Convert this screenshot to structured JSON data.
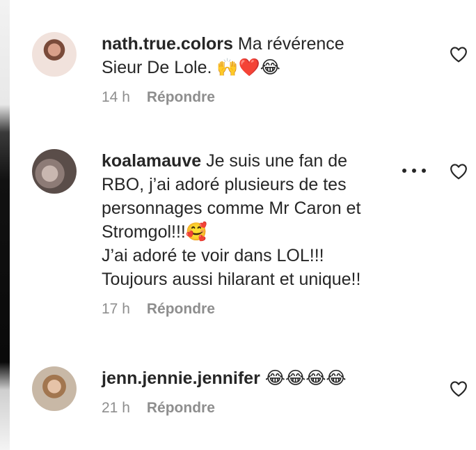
{
  "comments": [
    {
      "username": "nath.true.colors",
      "text": " Ma révérence\nSieur De Lole. 🙌❤️😂",
      "time": "14 h",
      "reply_label": "Répondre"
    },
    {
      "username": "koalamauve",
      "text": " Je suis une fan de\nRBO, j’ai adoré plusieurs de tes\npersonnages comme Mr Caron et\nStromgol!!!🥰\nJ’ai adoré te voir dans LOL!!!\nToujours aussi hilarant et unique!!",
      "time": "17 h",
      "reply_label": "Répondre"
    },
    {
      "username": "jenn.jennie.jennifer",
      "text": " 😂😂😂😂",
      "time": "21 h",
      "reply_label": "Répondre"
    }
  ],
  "icons": {
    "like": "heart-outline-icon",
    "more": "more-options-icon"
  }
}
